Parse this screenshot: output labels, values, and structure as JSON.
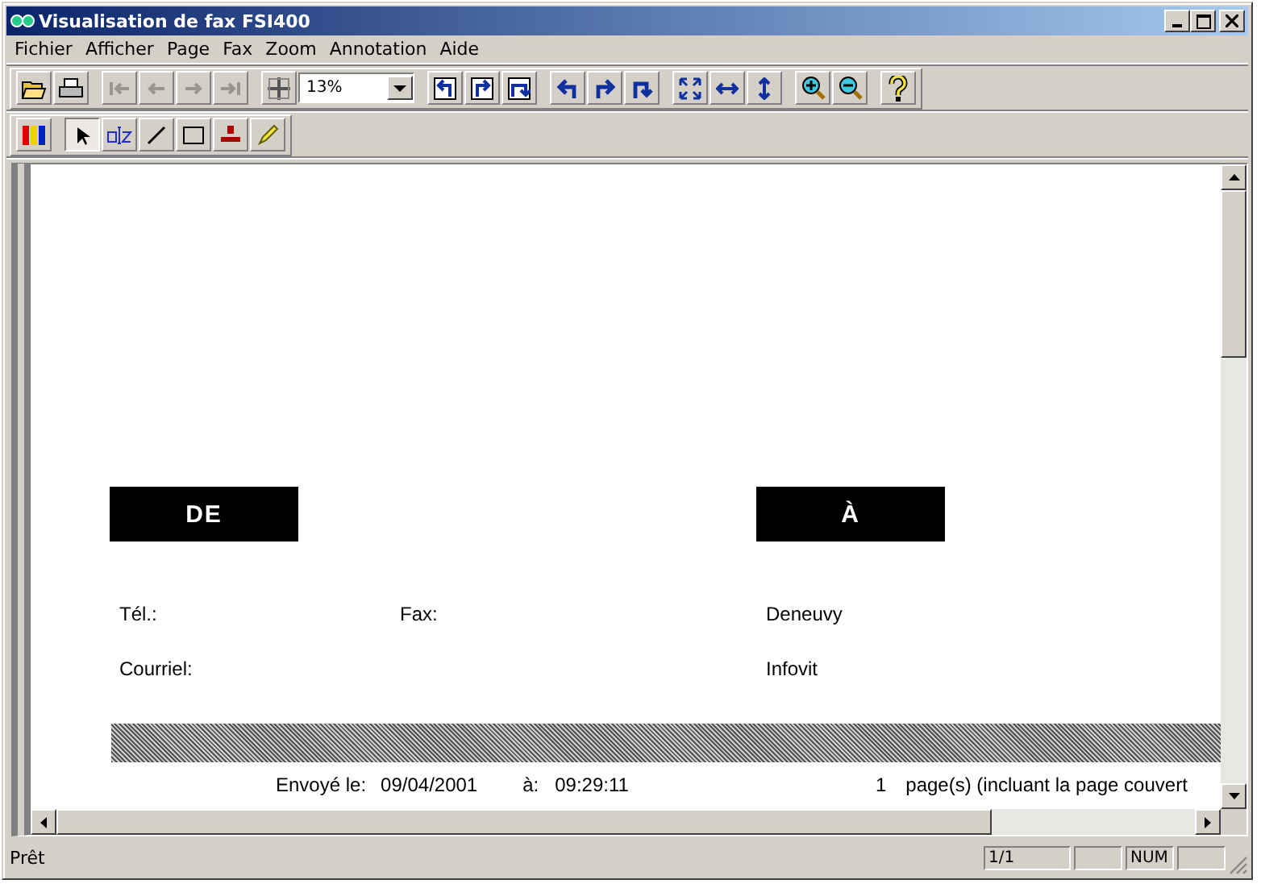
{
  "window": {
    "title": "Visualisation de fax FSI400"
  },
  "menu": [
    "Fichier",
    "Afficher",
    "Page",
    "Fax",
    "Zoom",
    "Annotation",
    "Aide"
  ],
  "toolbar": {
    "nav_buttons": [
      {
        "disabled": true
      },
      {
        "disabled": true
      },
      {
        "disabled": true
      },
      {
        "disabled": true
      }
    ],
    "zoom_value": "13%"
  },
  "annotation_tools": [
    {
      "selected": true
    },
    {
      "selected": false
    },
    {
      "selected": false
    },
    {
      "selected": false
    },
    {
      "selected": false
    },
    {
      "selected": false
    }
  ],
  "document": {
    "from_header": "DE",
    "to_header": "À",
    "fields": [
      {
        "label": "Tél.:",
        "label2": "Fax:",
        "value": "Deneuvy"
      },
      {
        "label": "Courriel:",
        "value": "Infovit"
      }
    ],
    "sent_label": "Envoyé le:",
    "sent_date": "09/04/2001",
    "at_label": "à:",
    "sent_time": "09:29:11",
    "page_count": "1",
    "pages_text": "page(s) (incluant la page couvert"
  },
  "status_bar": {
    "message": "Prêt",
    "page": "1/1",
    "num": "NUM"
  }
}
